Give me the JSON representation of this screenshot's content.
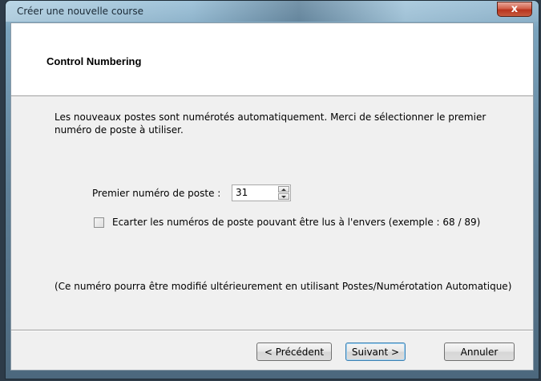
{
  "window": {
    "title": "Créer une nouvelle course",
    "close_glyph": "x"
  },
  "header": {
    "title": "Control Numbering"
  },
  "content": {
    "intro_text": "Les nouveaux postes sont numérotés automatiquement. Merci de sélectionner le premier numéro de poste à utiliser.",
    "first_number_label": "Premier numéro de poste :",
    "first_number_value": "31",
    "skip_reversible_label": "Ecarter les numéros de poste pouvant être lus à l'envers (exemple : 68 / 89)",
    "skip_reversible_checked": false,
    "note_text": "(Ce numéro pourra être modifié ultérieurement en utilisant Postes/Numérotation Automatique)"
  },
  "buttons": {
    "previous": "< Précédent",
    "next": "Suivant >",
    "cancel": "Annuler"
  },
  "icons": {
    "close": "close-icon",
    "spin_up": "chevron-up-icon",
    "spin_down": "chevron-down-icon"
  },
  "colors": {
    "client_background": "#f0f0f0",
    "header_background": "#ffffff",
    "default_button_border": "#3c7fb1",
    "close_button": "#c65a3e"
  }
}
